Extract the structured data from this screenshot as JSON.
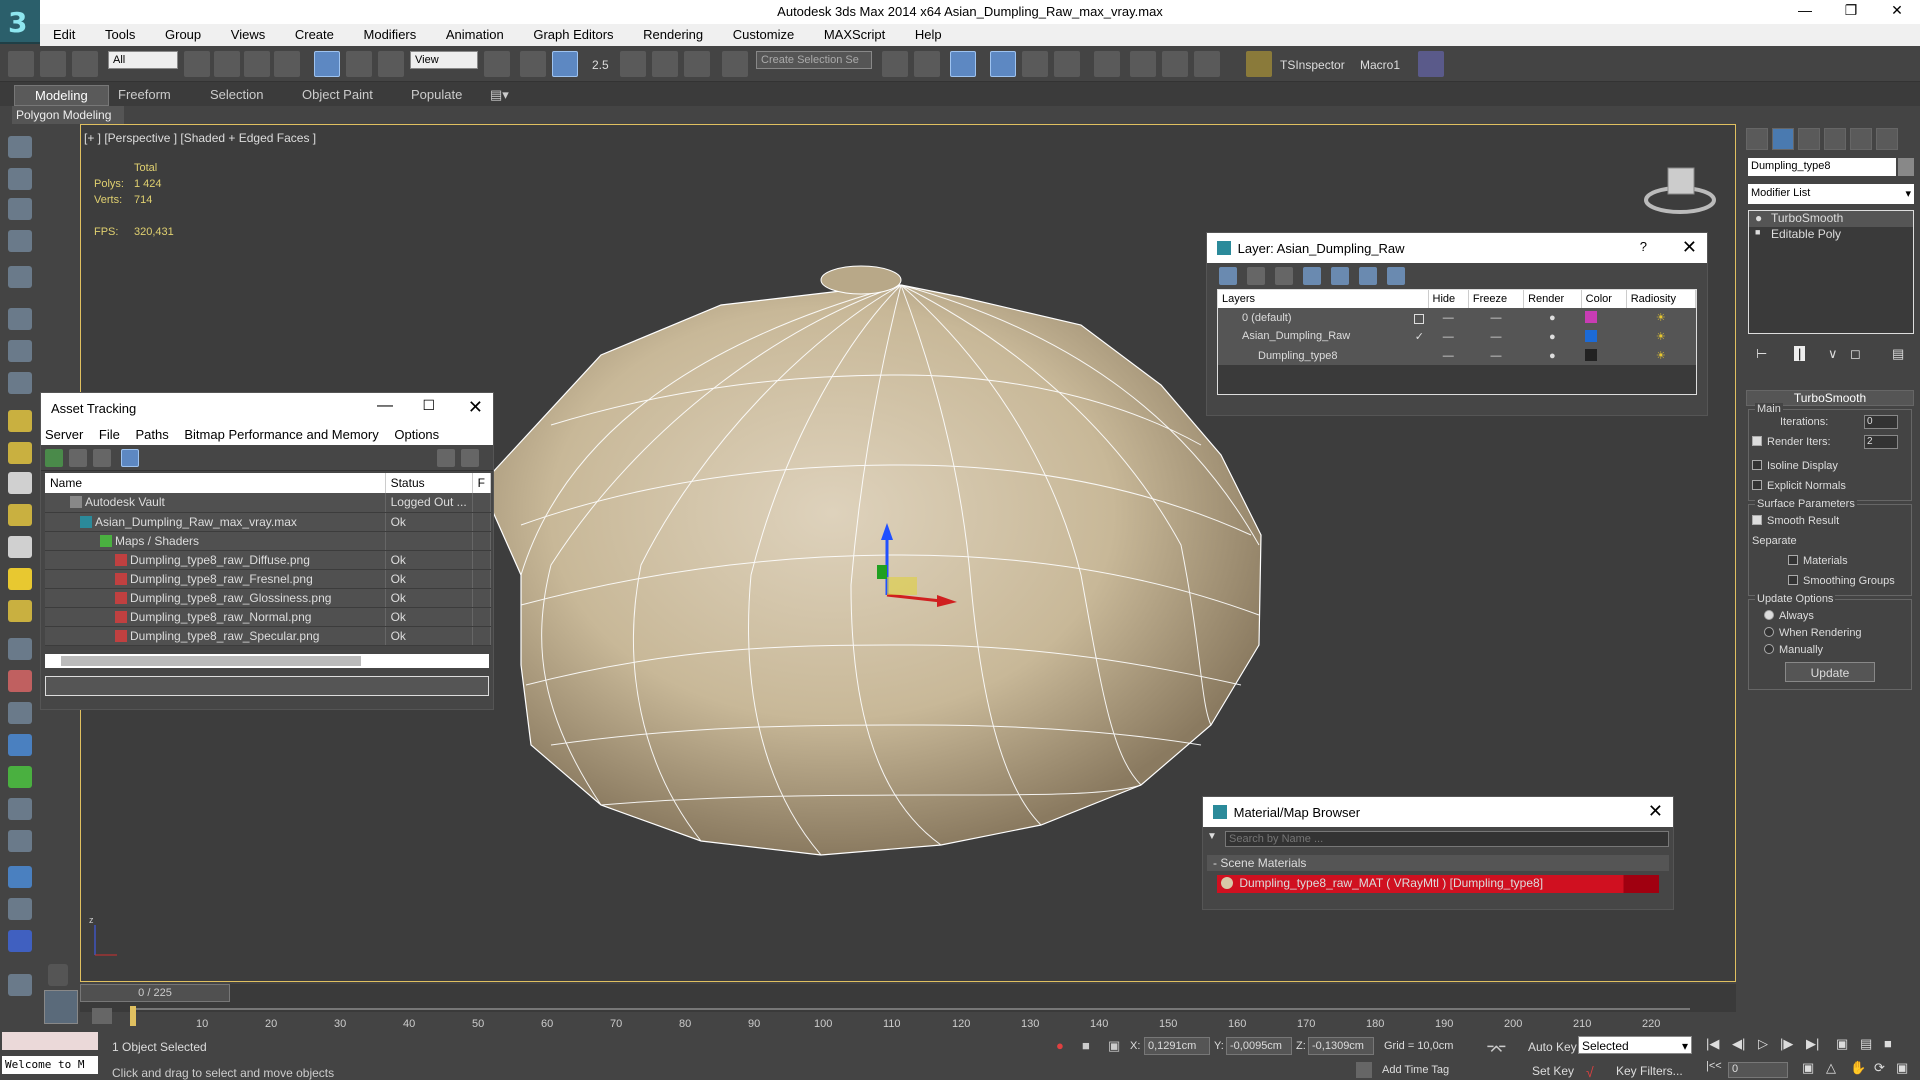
{
  "app": {
    "title": "Autodesk 3ds Max  2014 x64    Asian_Dumpling_Raw_max_vray.max"
  },
  "menu": [
    "Edit",
    "Tools",
    "Group",
    "Views",
    "Create",
    "Modifiers",
    "Animation",
    "Graph Editors",
    "Rendering",
    "Customize",
    "MAXScript",
    "Help"
  ],
  "toolbar": {
    "selection_filter": "All",
    "ref_coord": "View",
    "snap_value": "2.5",
    "selection_set": "Create Selection Se",
    "tsinspector": "TSInspector",
    "macro1": "Macro1"
  },
  "ribbon": {
    "tabs": [
      "Modeling",
      "Freeform",
      "Selection",
      "Object Paint",
      "Populate"
    ],
    "subtitle": "Polygon Modeling"
  },
  "viewport": {
    "label": "[+ ] [Perspective ] [Shaded + Edged Faces ]",
    "stats": {
      "header": "Total",
      "polys_label": "Polys:",
      "polys": "1 424",
      "verts_label": "Verts:",
      "verts": "714",
      "fps_label": "FPS:",
      "fps": "320,431"
    }
  },
  "asset_tracking": {
    "title": "Asset Tracking",
    "menu": [
      "Server",
      "File",
      "Paths",
      "Bitmap Performance and Memory",
      "Options"
    ],
    "columns": [
      "Name",
      "Status",
      "F"
    ],
    "rows": [
      {
        "name": "Autodesk Vault",
        "status": "Logged Out ..."
      },
      {
        "name": "Asian_Dumpling_Raw_max_vray.max",
        "status": "Ok"
      },
      {
        "name": "Maps / Shaders",
        "status": ""
      },
      {
        "name": "Dumpling_type8_raw_Diffuse.png",
        "status": "Ok"
      },
      {
        "name": "Dumpling_type8_raw_Fresnel.png",
        "status": "Ok"
      },
      {
        "name": "Dumpling_type8_raw_Glossiness.png",
        "status": "Ok"
      },
      {
        "name": "Dumpling_type8_raw_Normal.png",
        "status": "Ok"
      },
      {
        "name": "Dumpling_type8_raw_Specular.png",
        "status": "Ok"
      }
    ]
  },
  "layer_window": {
    "title": "Layer: Asian_Dumpling_Raw",
    "columns": [
      "Layers",
      "Hide",
      "Freeze",
      "Render",
      "Color",
      "Radiosity"
    ],
    "rows": [
      {
        "name": "0 (default)",
        "color": "#c83cb4"
      },
      {
        "name": "Asian_Dumpling_Raw",
        "color": "#1c6ad6"
      },
      {
        "name": "Dumpling_type8",
        "color": "#222222"
      }
    ]
  },
  "material_browser": {
    "title": "Material/Map Browser",
    "search_placeholder": "Search by Name ...",
    "section": "Scene Materials",
    "item": "Dumpling_type8_raw_MAT  ( VRayMtl )  [Dumpling_type8]"
  },
  "command_panel": {
    "object_name": "Dumpling_type8",
    "modifier_list": "Modifier List",
    "stack": [
      "TurboSmooth",
      "Editable Poly"
    ],
    "turbosmooth": {
      "title": "TurboSmooth",
      "main": "Main",
      "iterations_label": "Iterations:",
      "iterations": "0",
      "render_iters_label": "Render Iters:",
      "render_iters": "2",
      "isoline": "Isoline Display",
      "explicit_normals": "Explicit Normals",
      "surface_params": "Surface Parameters",
      "smooth_result": "Smooth Result",
      "separate": "Separate",
      "materials": "Materials",
      "smoothing_groups": "Smoothing Groups",
      "update_options": "Update Options",
      "always": "Always",
      "when_rendering": "When Rendering",
      "manually": "Manually",
      "update_button": "Update"
    }
  },
  "timeline": {
    "frame": "0 / 225",
    "ticks": [
      "10",
      "20",
      "30",
      "40",
      "50",
      "60",
      "70",
      "80",
      "90",
      "100",
      "110",
      "120",
      "130",
      "140",
      "150",
      "160",
      "170",
      "180",
      "190",
      "200",
      "210",
      "220"
    ]
  },
  "status": {
    "maxscript": "Welcome to M",
    "selection": "1 Object Selected",
    "prompt": "Click and drag to select and move objects",
    "x_label": "X:",
    "x": "0,1291cm",
    "y_label": "Y:",
    "y": "-0,0095cm",
    "z_label": "Z:",
    "z": "-0,1309cm",
    "grid": "Grid = 10,0cm",
    "add_time_tag": "Add Time Tag",
    "auto_key": "Auto Key",
    "set_key": "Set Key",
    "selected": "Selected",
    "key_filters": "Key Filters...",
    "frame_field": "0"
  }
}
